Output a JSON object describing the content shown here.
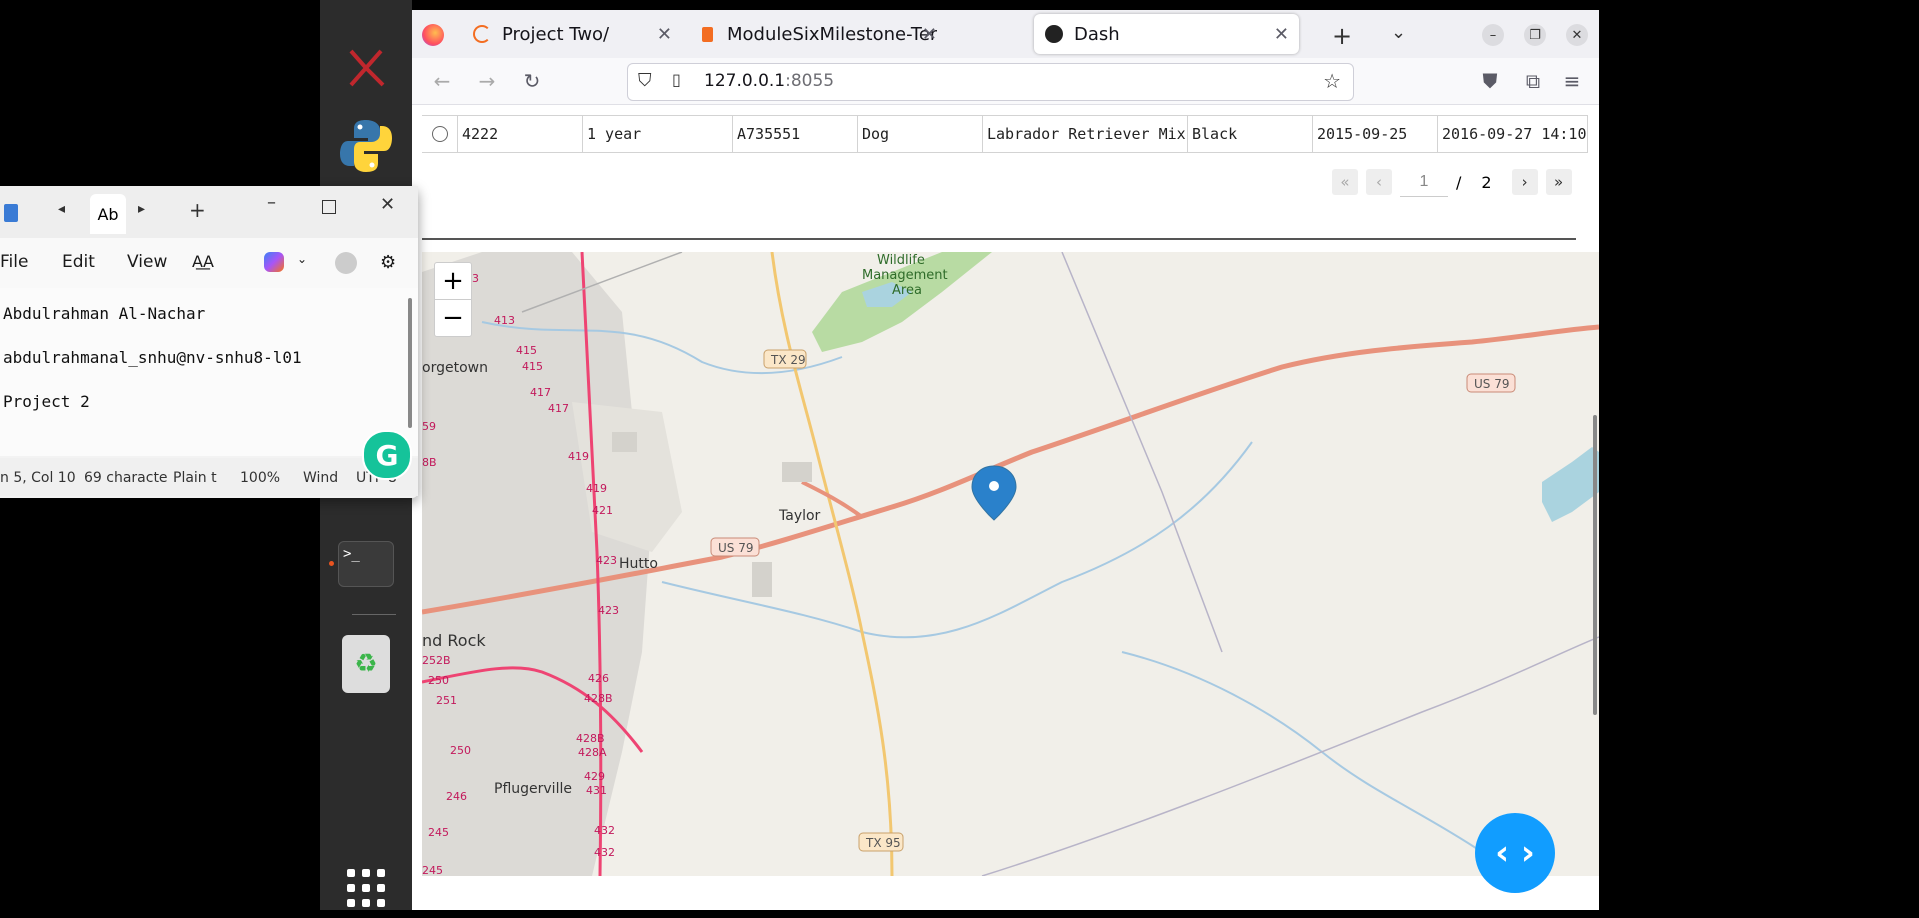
{
  "browser": {
    "tabs": [
      {
        "label": "Project Two/"
      },
      {
        "label": "ModuleSixMilestone-Tem"
      },
      {
        "label": "Dash"
      }
    ],
    "url_host": "127.0.0.1",
    "url_port": ":8055"
  },
  "table": {
    "row": [
      "4222",
      "1 year",
      "A735551",
      "Dog",
      "Labrador Retriever Mix",
      "Black",
      "2015-09-25",
      "2016-09-27 14:10"
    ]
  },
  "pager": {
    "current": "1",
    "separator": "/",
    "total": "2"
  },
  "map": {
    "zoom_in": "+",
    "zoom_out": "−",
    "labels": {
      "wildlife": "Wildlife",
      "management": "Management",
      "area": "Area",
      "georgetown": "orgetown",
      "taylor": "Taylor",
      "hutto": "Hutto",
      "round_rock": "nd Rock",
      "pflugerville": "Pflugerville",
      "tx29": "TX 29",
      "us79_right": "US 79",
      "us79_center": "US 79",
      "tx95": "TX 95",
      "r413": "413",
      "r415": "415",
      "r415b": "415",
      "r417": "417",
      "r417b": "417",
      "r419": "419",
      "r419b": "419",
      "r421": "421",
      "r423": "423",
      "r423b": "423",
      "r426": "426",
      "r428b": "428B",
      "r428b2": "428B",
      "r428a": "428A",
      "r429": "429",
      "r431": "431",
      "r432": "432",
      "r432b": "432",
      "r252b": "252B",
      "r250": "250",
      "r251": "251",
      "r250b": "250",
      "r246": "246",
      "r245": "245",
      "r245b": "245",
      "r59": "59",
      "r8b": "8B",
      "r3": "3"
    },
    "marker_color": "#2a81cb"
  },
  "notepad": {
    "tab_label": "Ab",
    "menu": {
      "file": "File",
      "edit": "Edit",
      "view": "View"
    },
    "lines": [
      "Abdulrahman Al-Nachar",
      "abdulrahmanal_snhu@nv-snhu8-l01",
      "Project 2"
    ],
    "status": {
      "position": "n 5, Col 10",
      "chars": "69 characte",
      "format": "Plain t",
      "zoom": "100%",
      "eol": "Wind",
      "encoding": "UTF-8"
    }
  },
  "grammarly_label": "G",
  "dash_dev_label": "‹ ›"
}
